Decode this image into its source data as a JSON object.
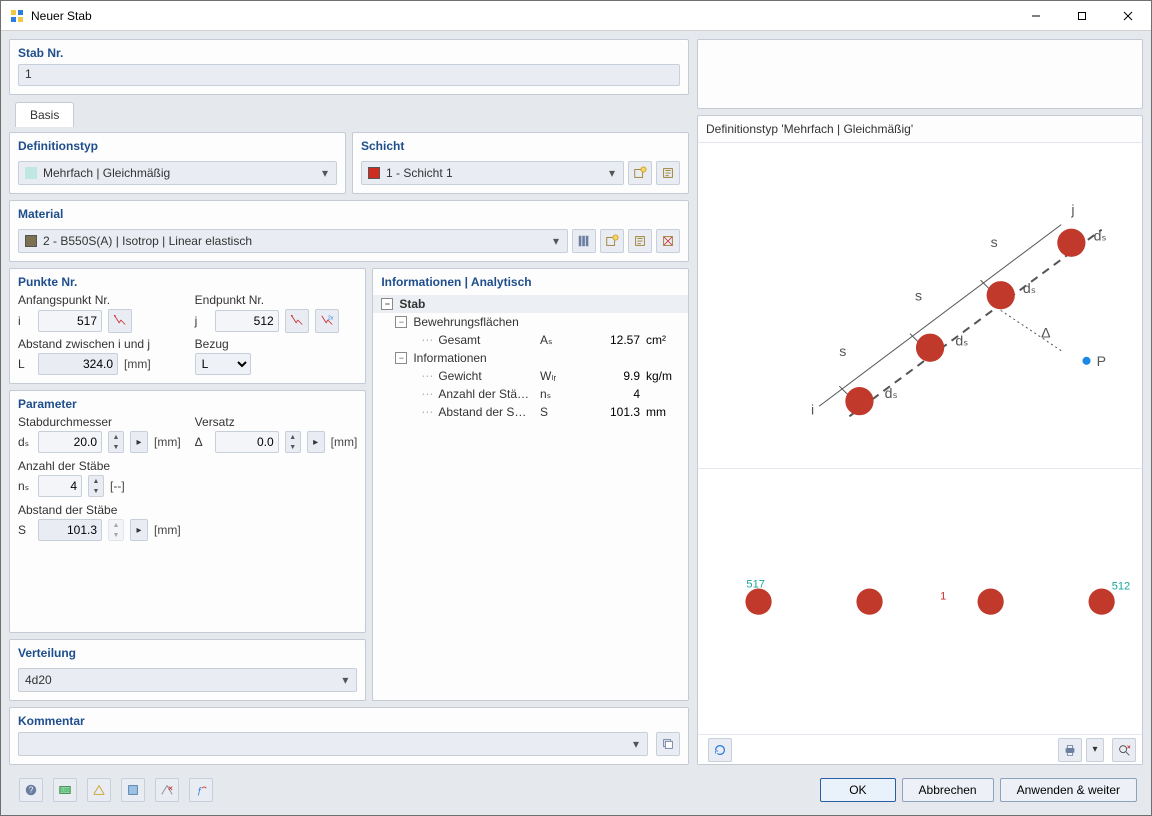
{
  "window": {
    "title": "Neuer Stab"
  },
  "stab_nr": {
    "label": "Stab Nr.",
    "value": "1"
  },
  "tabs": {
    "basis": "Basis"
  },
  "def_type": {
    "label": "Definitionstyp",
    "selected": "Mehrfach | Gleichmäßig"
  },
  "schicht": {
    "label": "Schicht",
    "selected": "1 - Schicht 1",
    "swatch": "#d12b1f"
  },
  "material": {
    "label": "Material",
    "selected": "2 - B550S(A) | Isotrop | Linear elastisch",
    "swatch": "#7d7050"
  },
  "punkte": {
    "label": "Punkte Nr.",
    "start_label": "Anfangspunkt Nr.",
    "start_prefix": "i",
    "start_value": "517",
    "end_label": "Endpunkt Nr.",
    "end_prefix": "j",
    "end_value": "512",
    "dist_label": "Abstand zwischen i und j",
    "dist_prefix": "L",
    "dist_value": "324.0",
    "dist_unit": "[mm]",
    "bezug_label": "Bezug",
    "bezug_value": "L"
  },
  "params": {
    "label": "Parameter",
    "d_label": "Stabdurchmesser",
    "d_prefix": "dₛ",
    "d_value": "20.0",
    "d_unit": "[mm]",
    "v_label": "Versatz",
    "v_prefix": "Δ",
    "v_value": "0.0",
    "v_unit": "[mm]",
    "n_label": "Anzahl der Stäbe",
    "n_prefix": "nₛ",
    "n_value": "4",
    "n_unit": "[--]",
    "s_label": "Abstand der Stäbe",
    "s_prefix": "S",
    "s_value": "101.3",
    "s_unit": "[mm]"
  },
  "info": {
    "title": "Informationen | Analytisch",
    "group0": "Stab",
    "group1": "Bewehrungsflächen",
    "g1_gesamt": {
      "label": "Gesamt",
      "sym": "Aₛ",
      "val": "12.57",
      "unit": "cm²"
    },
    "group2": "Informationen",
    "g2_gewicht": {
      "label": "Gewicht",
      "sym": "Wₗᵣ",
      "val": "9.9",
      "unit": "kg/m"
    },
    "g2_ns": {
      "label": "Anzahl der Stä…",
      "sym": "nₛ",
      "val": "4",
      "unit": ""
    },
    "g2_s": {
      "label": "Abstand der S…",
      "sym": "S",
      "val": "101.3",
      "unit": "mm"
    }
  },
  "verteilung": {
    "label": "Verteilung",
    "value": "4d20"
  },
  "kommentar": {
    "label": "Kommentar",
    "value": ""
  },
  "preview": {
    "title": "Definitionstyp 'Mehrfach | Gleichmäßig'",
    "labels": {
      "s": "s",
      "ds": "dₛ",
      "i": "i",
      "j": "j",
      "delta": "Δ",
      "p": "P"
    },
    "bottom": {
      "left_id": "517",
      "right_id": "512",
      "mid_id": "1"
    }
  },
  "buttons": {
    "ok": "OK",
    "cancel": "Abbrechen",
    "apply": "Anwenden & weiter"
  }
}
